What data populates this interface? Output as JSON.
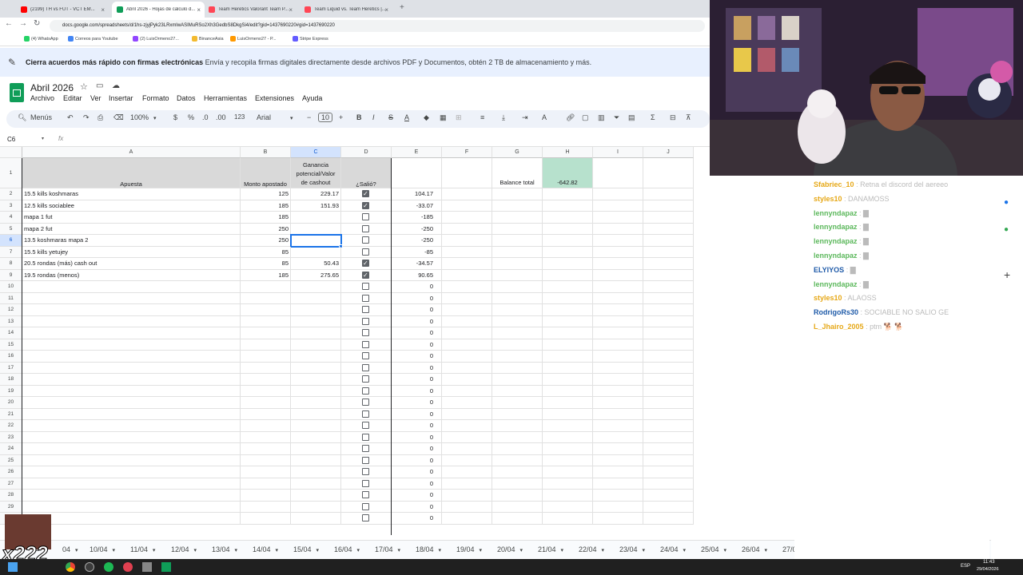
{
  "browser": {
    "tabs": [
      {
        "label": "(2199) TH vs FUT - VCT EM...",
        "color": "#ff0000",
        "active": false
      },
      {
        "label": "Abril 2026 - Hojas de cálculo d...",
        "color": "#0f9d58",
        "active": true
      },
      {
        "label": "Team Heretics Valorant Team P...",
        "color": "#ff4655",
        "active": false
      },
      {
        "label": "Team Liquid vs. Team Heretics |...",
        "color": "#ff4655",
        "active": false
      }
    ],
    "url": "docs.google.com/spreadsheets/d/1hs-zjyjPyk23LRxmlwASIMuRSo2Xh3GedbS8DkgSi4/edit?gid=1437690220#gid=1437690220",
    "bookmarks": [
      "(4) WhatsApp",
      "Correos para Youtube",
      "(2) LuisOrmeno27...",
      "BinanceAsia",
      "LuisOrmeno27 - P...",
      "Stripe Express"
    ]
  },
  "banner": {
    "bold": "Cierra acuerdos más rápido con firmas electrónicas",
    "text": " Envía y recopila firmas digitales directamente desde archivos PDF y Documentos, obtén 2 TB de almacenamiento y más."
  },
  "doc": {
    "title": "Abril 2026",
    "menus": [
      "Archivo",
      "Editar",
      "Ver",
      "Insertar",
      "Formato",
      "Datos",
      "Herramientas",
      "Extensiones",
      "Ayuda"
    ]
  },
  "toolbar": {
    "menus": "Menús",
    "zoom": "100%",
    "currency": "$",
    "percent": "%",
    "dec_less": ".0",
    "dec_more": ".00",
    "format_123": "123",
    "font": "Arial",
    "font_size": "10",
    "minus": "−",
    "plus": "+",
    "bold": "B",
    "italic": "I",
    "strike": "S",
    "textcolor": "A"
  },
  "formula_bar": {
    "cell_ref": "C6",
    "fx": "fx",
    "value": ""
  },
  "columns": [
    "A",
    "B",
    "C",
    "D",
    "E",
    "F",
    "G",
    "H",
    "I",
    "J"
  ],
  "selected_cell": "C6",
  "header_row": {
    "apuesta": "Apuesta",
    "monto": "Monto apostado",
    "ganancia": "Ganancia potencial/Valor de cashout",
    "salio": "¿Salió?",
    "balance_label": "Balance total",
    "balance_value": "-642.82"
  },
  "rows": [
    {
      "n": "2",
      "apuesta": "15.5 kills koshmaras",
      "monto": "125",
      "ganancia": "229.17",
      "salio": true,
      "e": "104.17"
    },
    {
      "n": "3",
      "apuesta": "12.5 kills sociablee",
      "monto": "185",
      "ganancia": "151.93",
      "salio": true,
      "e": "-33.07"
    },
    {
      "n": "4",
      "apuesta": "mapa 1 fut",
      "monto": "185",
      "ganancia": "",
      "salio": false,
      "e": "-185"
    },
    {
      "n": "5",
      "apuesta": "mapa 2 fut",
      "monto": "250",
      "ganancia": "",
      "salio": false,
      "e": "-250"
    },
    {
      "n": "6",
      "apuesta": "13.5 koshmaras mapa 2",
      "monto": "250",
      "ganancia": "",
      "salio": false,
      "e": "-250"
    },
    {
      "n": "7",
      "apuesta": "15.5 kills yetujey",
      "monto": "85",
      "ganancia": "",
      "salio": false,
      "e": "-85"
    },
    {
      "n": "8",
      "apuesta": "20.5 rondas (más) cash out",
      "monto": "85",
      "ganancia": "50.43",
      "salio": true,
      "e": "-34.57"
    },
    {
      "n": "9",
      "apuesta": "19.5 rondas (menos)",
      "monto": "185",
      "ganancia": "275.65",
      "salio": true,
      "e": "90.65"
    },
    {
      "n": "10",
      "apuesta": "",
      "monto": "",
      "ganancia": "",
      "salio": false,
      "e": "0"
    },
    {
      "n": "11",
      "apuesta": "",
      "monto": "",
      "ganancia": "",
      "salio": false,
      "e": "0"
    },
    {
      "n": "12",
      "apuesta": "",
      "monto": "",
      "ganancia": "",
      "salio": false,
      "e": "0"
    },
    {
      "n": "13",
      "apuesta": "",
      "monto": "",
      "ganancia": "",
      "salio": false,
      "e": "0"
    },
    {
      "n": "14",
      "apuesta": "",
      "monto": "",
      "ganancia": "",
      "salio": false,
      "e": "0"
    },
    {
      "n": "15",
      "apuesta": "",
      "monto": "",
      "ganancia": "",
      "salio": false,
      "e": "0"
    },
    {
      "n": "16",
      "apuesta": "",
      "monto": "",
      "ganancia": "",
      "salio": false,
      "e": "0"
    },
    {
      "n": "17",
      "apuesta": "",
      "monto": "",
      "ganancia": "",
      "salio": false,
      "e": "0"
    },
    {
      "n": "18",
      "apuesta": "",
      "monto": "",
      "ganancia": "",
      "salio": false,
      "e": "0"
    },
    {
      "n": "19",
      "apuesta": "",
      "monto": "",
      "ganancia": "",
      "salio": false,
      "e": "0"
    },
    {
      "n": "20",
      "apuesta": "",
      "monto": "",
      "ganancia": "",
      "salio": false,
      "e": "0"
    },
    {
      "n": "21",
      "apuesta": "",
      "monto": "",
      "ganancia": "",
      "salio": false,
      "e": "0"
    },
    {
      "n": "22",
      "apuesta": "",
      "monto": "",
      "ganancia": "",
      "salio": false,
      "e": "0"
    },
    {
      "n": "23",
      "apuesta": "",
      "monto": "",
      "ganancia": "",
      "salio": false,
      "e": "0"
    },
    {
      "n": "24",
      "apuesta": "",
      "monto": "",
      "ganancia": "",
      "salio": false,
      "e": "0"
    },
    {
      "n": "25",
      "apuesta": "",
      "monto": "",
      "ganancia": "",
      "salio": false,
      "e": "0"
    },
    {
      "n": "26",
      "apuesta": "",
      "monto": "",
      "ganancia": "",
      "salio": false,
      "e": "0"
    },
    {
      "n": "27",
      "apuesta": "",
      "monto": "",
      "ganancia": "",
      "salio": false,
      "e": "0"
    },
    {
      "n": "28",
      "apuesta": "",
      "monto": "",
      "ganancia": "",
      "salio": false,
      "e": "0"
    },
    {
      "n": "29",
      "apuesta": "",
      "monto": "",
      "ganancia": "",
      "salio": false,
      "e": "0"
    },
    {
      "n": "30",
      "apuesta": "",
      "monto": "",
      "ganancia": "",
      "salio": false,
      "e": "0"
    }
  ],
  "sheet_tabs": [
    "04",
    "10/04",
    "11/04",
    "12/04",
    "13/04",
    "14/04",
    "15/04",
    "16/04",
    "17/04",
    "18/04",
    "19/04",
    "20/04",
    "21/04",
    "22/04",
    "23/04",
    "24/04",
    "25/04",
    "26/04",
    "27/04",
    "28/04",
    "29/04"
  ],
  "active_sheet": "29/04",
  "chat": [
    {
      "user": "Sfabriec_10",
      "msg": ": Retna el discord del aereeo",
      "color": "#e6a817"
    },
    {
      "user": "styles10",
      "msg": ": DANAMOSS",
      "color": "#e6a817"
    },
    {
      "user": "lennyndapaz",
      "msg": ": ▇",
      "color": "#5cb85c"
    },
    {
      "user": "lennyndapaz",
      "msg": ": ▇",
      "color": "#5cb85c"
    },
    {
      "user": "lennyndapaz",
      "msg": ": ▇",
      "color": "#5cb85c"
    },
    {
      "user": "lennyndapaz",
      "msg": ": ▇",
      "color": "#5cb85c"
    },
    {
      "user": "ELYIYOS",
      "msg": ": ▇",
      "color": "#1e5aa8"
    },
    {
      "user": "lennyndapaz",
      "msg": ": ▇",
      "color": "#5cb85c"
    },
    {
      "user": "styles10",
      "msg": ": ALAOSS",
      "color": "#e6a817"
    },
    {
      "user": "RodrigoRs30",
      "msg": ": SOCIABLE NO SALIO GE",
      "color": "#1e5aa8"
    },
    {
      "user": "L_Jhairo_2005",
      "msg": ": ptm 🐕 🐕",
      "color": "#e6a817"
    }
  ],
  "taskbar": {
    "lang": "ESP",
    "time": "11:43",
    "date": "29/04/2026"
  },
  "overlay_text": "x222"
}
